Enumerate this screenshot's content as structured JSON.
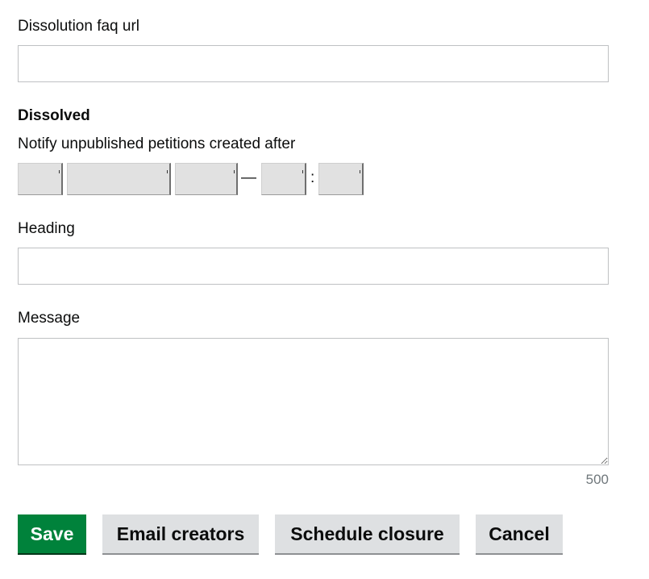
{
  "form": {
    "faq_url": {
      "label": "Dissolution faq url",
      "value": ""
    },
    "dissolved": {
      "heading": "Dissolved",
      "notify_label": "Notify unpublished petitions created after",
      "date_separator": "—",
      "time_separator": ":"
    },
    "heading": {
      "label": "Heading",
      "value": ""
    },
    "message": {
      "label": "Message",
      "value": "",
      "char_counter": "500"
    }
  },
  "actions": {
    "save": "Save",
    "email_creators": "Email creators",
    "schedule_closure": "Schedule closure",
    "cancel": "Cancel"
  },
  "colors": {
    "primary_button": "#00823b",
    "secondary_button": "#dee0e2",
    "border": "#bfc1c3",
    "counter_text": "#6f777b"
  }
}
